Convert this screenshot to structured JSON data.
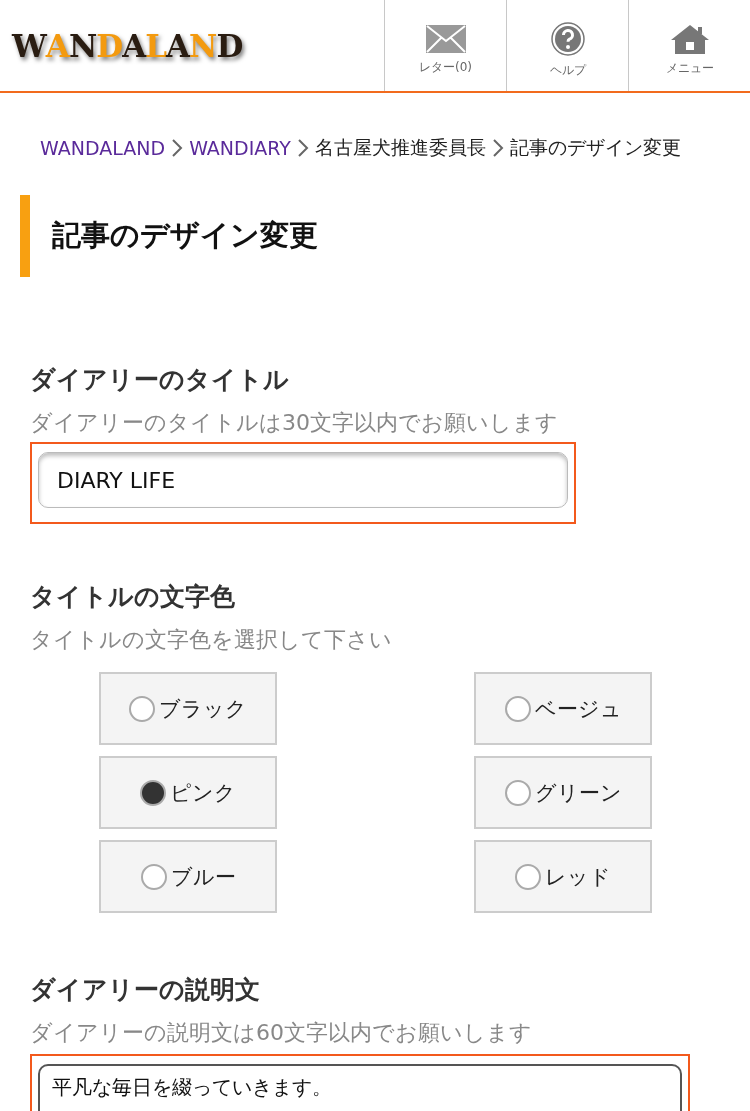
{
  "header": {
    "logo": "WANDALAND",
    "nav": [
      {
        "kind": "mail",
        "label": "レター(0)"
      },
      {
        "kind": "help",
        "label": "ヘルプ"
      },
      {
        "kind": "home",
        "label": "メニュー"
      }
    ]
  },
  "breadcrumb": [
    {
      "label": "WANDALAND",
      "link": true
    },
    {
      "label": "WANDIARY",
      "link": true
    },
    {
      "label": "名古屋犬推進委員長",
      "link": false
    },
    {
      "label": "記事のデザイン変更",
      "link": false
    }
  ],
  "page_title": "記事のデザイン変更",
  "sections": [
    {
      "kind": "text",
      "title": "ダイアリーのタイトル",
      "hint": "ダイアリーのタイトルは30文字以内でお願いします",
      "value": "DIARY LIFE"
    },
    {
      "kind": "radio",
      "title": "タイトルの文字色",
      "hint": "タイトルの文字色を選択して下さい",
      "options": [
        {
          "label": "ブラック",
          "selected": false
        },
        {
          "label": "ベージュ",
          "selected": false
        },
        {
          "label": "ピンク",
          "selected": true
        },
        {
          "label": "グリーン",
          "selected": false
        },
        {
          "label": "ブルー",
          "selected": false
        },
        {
          "label": "レッド",
          "selected": false
        }
      ]
    },
    {
      "kind": "textarea",
      "title": "ダイアリーの説明文",
      "hint": "ダイアリーの説明文は60文字以内でお願いします",
      "value": "平凡な毎日を綴っていきます。"
    }
  ]
}
